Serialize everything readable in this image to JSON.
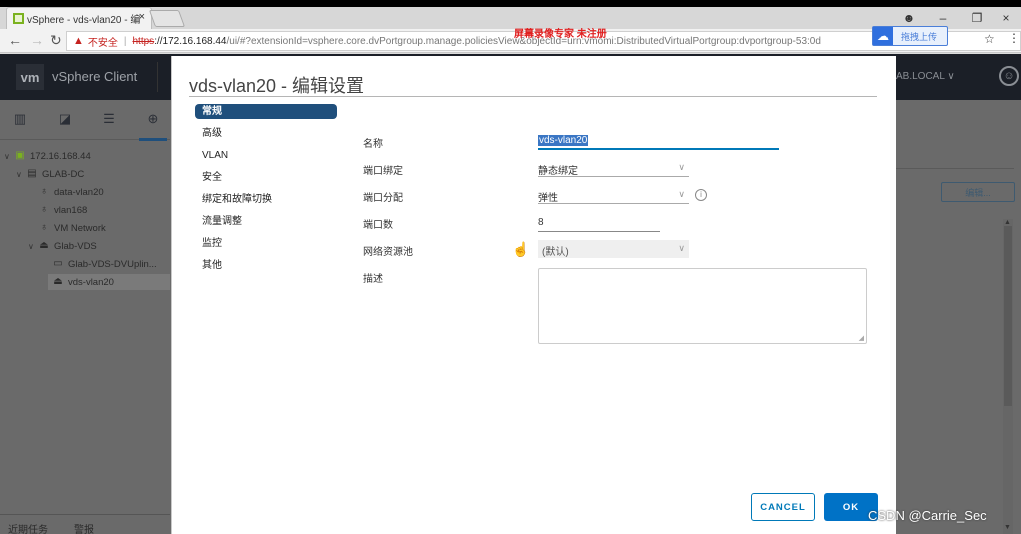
{
  "browser": {
    "tab_title": "vSphere - vds-vlan20 - 编",
    "tab_close": "×",
    "window_controls": {
      "profile": "☻",
      "minimize": "–",
      "restore": "❐",
      "close": "×"
    },
    "nav": {
      "back": "←",
      "forward": "→",
      "reload": "↻"
    },
    "security_warning": "不安全",
    "url_scheme": "https",
    "url_host": "://172.16.168.44",
    "url_path": "/ui/#?extensionId=vsphere.core.dvPortgroup.manage.policiesView&objectId=urn:vmomi:DistributedVirtualPortgroup:dvportgroup-53:0d",
    "recorder_watermark": "屏幕录像专家 未注册",
    "cloud_upload_label": "拖拽上传",
    "bookmark_icon": "☆",
    "menu_icon": "⋮"
  },
  "app": {
    "logo": "vm",
    "title": "vSphere Client",
    "user_label": "AB.LOCAL ∨",
    "tree": [
      {
        "label": "172.16.168.44",
        "icon": "vcenter-icon",
        "expanded": true
      },
      {
        "label": "GLAB-DC",
        "icon": "datacenter-icon",
        "expanded": true
      },
      {
        "label": "data-vlan20",
        "icon": "network-icon"
      },
      {
        "label": "vlan168",
        "icon": "network-icon"
      },
      {
        "label": "VM Network",
        "icon": "network-icon"
      },
      {
        "label": "Glab-VDS",
        "icon": "dvswitch-icon",
        "expanded": true
      },
      {
        "label": "Glab-VDS-DVUplin...",
        "icon": "uplink-portgroup-icon"
      },
      {
        "label": "vds-vlan20",
        "icon": "portgroup-icon",
        "selected": true
      }
    ],
    "bottom_tabs": [
      "近期任务",
      "警报"
    ],
    "edit_button": "编辑..."
  },
  "modal": {
    "title": "vds-vlan20 - 编辑设置",
    "nav_items": [
      "常规",
      "高级",
      "VLAN",
      "安全",
      "绑定和故障切换",
      "流量调整",
      "监控",
      "其他"
    ],
    "active_nav": "常规",
    "fields": {
      "name_label": "名称",
      "name_value": "vds-vlan20",
      "port_binding_label": "端口绑定",
      "port_binding_value": "静态绑定",
      "port_allocation_label": "端口分配",
      "port_allocation_value": "弹性",
      "port_count_label": "端口数",
      "port_count_value": "8",
      "resource_pool_label": "网络资源池",
      "resource_pool_value": "(默认)",
      "description_label": "描述",
      "description_value": ""
    },
    "cancel_label": "CANCEL",
    "ok_label": "OK"
  },
  "watermark": "CSDN @Carrie_Sec",
  "colors": {
    "accent": "#0072c6",
    "nav_active": "#1f4f7c",
    "header_dark": "#1b1f27",
    "warning_red": "#c5221f"
  }
}
